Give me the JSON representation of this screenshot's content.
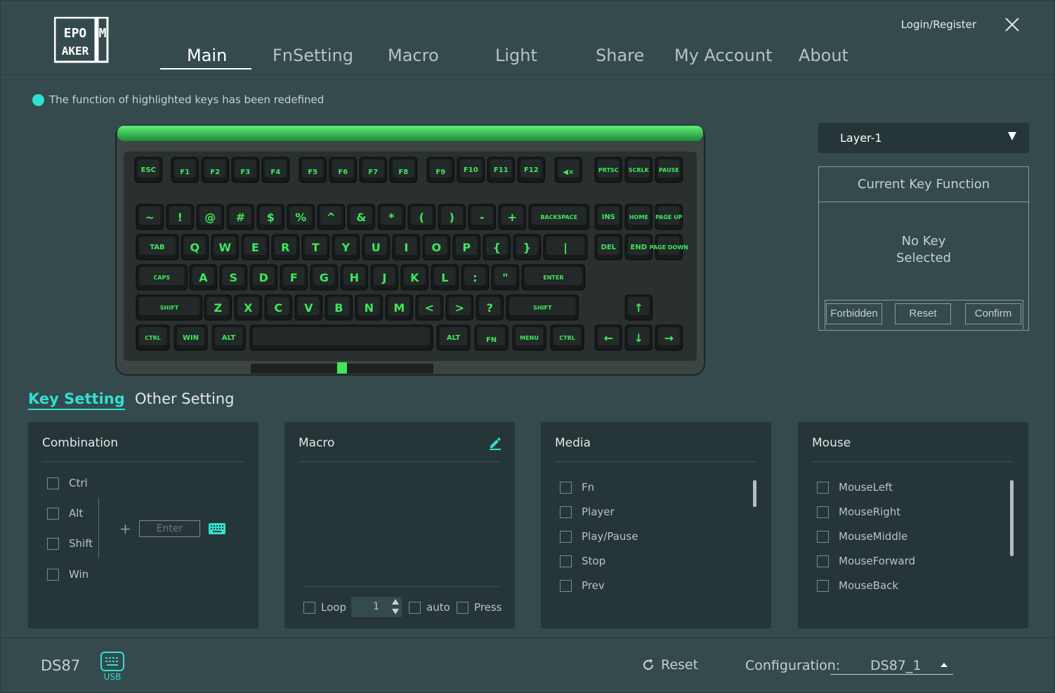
{
  "header": {
    "logo_text": "EPOMAKER",
    "login": "Login/Register",
    "tabs": [
      {
        "label": "Main",
        "active": true
      },
      {
        "label": "FnSetting"
      },
      {
        "label": "Macro"
      },
      {
        "label": "Light"
      },
      {
        "label": "Share"
      },
      {
        "label": "My Account"
      },
      {
        "label": "About"
      }
    ]
  },
  "notice": "The function of highlighted keys has been redefined",
  "keyboard": {
    "backlight_color": "#3ee85a",
    "rows": [
      [
        "ESC",
        "F1",
        "F2",
        "F3",
        "F4",
        "F5",
        "F6",
        "F7",
        "F8",
        "F9",
        "F10",
        "F11",
        "F12",
        "◀×",
        "PRTSC",
        "SCRLK",
        "PAUSE"
      ],
      [
        "~",
        "!",
        "@",
        "#",
        "$",
        "%",
        "^",
        "&",
        "*",
        "(",
        ")",
        "-",
        "+",
        "BACKSPACE",
        "INS",
        "HOME",
        "PAGE UP"
      ],
      [
        "TAB",
        "Q",
        "W",
        "E",
        "R",
        "T",
        "Y",
        "U",
        "I",
        "O",
        "P",
        "{",
        "}",
        "|",
        "DEL",
        "END",
        "PAGE DOWN"
      ],
      [
        "CAPS",
        "A",
        "S",
        "D",
        "F",
        "G",
        "H",
        "J",
        "K",
        "L",
        ":",
        "\"",
        "ENTER"
      ],
      [
        "SHIFT",
        "Z",
        "X",
        "C",
        "V",
        "B",
        "N",
        "M",
        "<",
        ">",
        "?",
        "SHIFT",
        "↑"
      ],
      [
        "CTRL",
        "WIN",
        "ALT",
        "",
        "ALT",
        "FN",
        "MENU",
        "CTRL",
        "←",
        "↓",
        "→"
      ]
    ]
  },
  "layer": {
    "selected": "Layer-1"
  },
  "current_key": {
    "title": "Current Key Function",
    "status": "No Key Selected",
    "forbidden": "Forbidden",
    "reset": "Reset",
    "confirm": "Confirm"
  },
  "settings_tabs": [
    {
      "label": "Key Setting",
      "active": true
    },
    {
      "label": "Other Setting"
    }
  ],
  "combination": {
    "title": "Combination",
    "modifiers": [
      "Ctrl",
      "Alt",
      "Shift",
      "Win"
    ],
    "plus": "+",
    "enter_placeholder": "Enter"
  },
  "macro": {
    "title": "Macro",
    "loop_label": "Loop",
    "loop_value": "1",
    "auto_label": "auto",
    "press_label": "Press"
  },
  "media": {
    "title": "Media",
    "items": [
      "Fn",
      "Player",
      "Play/Pause",
      "Stop",
      "Prev"
    ]
  },
  "mouse": {
    "title": "Mouse",
    "items": [
      "MouseLeft",
      "MouseRight",
      "MouseMiddle",
      "MouseForward",
      "MouseBack"
    ]
  },
  "footer": {
    "model": "DS87",
    "connection": "USB",
    "reset": "Reset",
    "config_label": "Configuration:",
    "config_value": "DS87_1"
  },
  "colors": {
    "accent": "#2fe0d2",
    "background": "#344a4d",
    "panel": "#263537",
    "key_green": "#3ee85a"
  }
}
